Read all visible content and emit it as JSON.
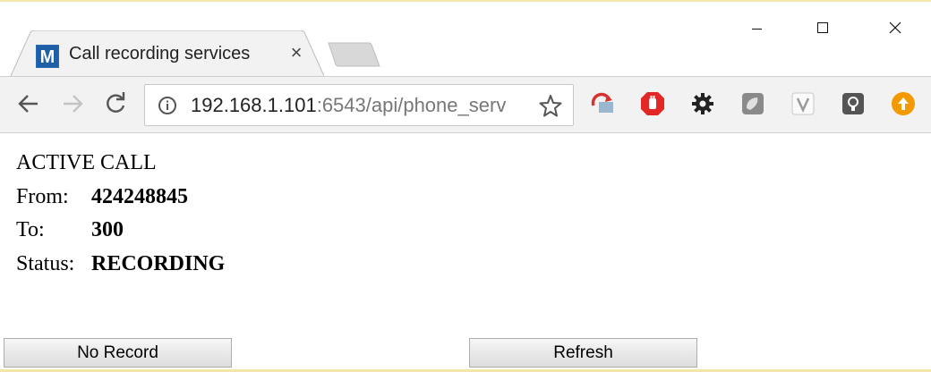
{
  "browser": {
    "tab": {
      "favicon_letter": "M",
      "title": "Call recording services",
      "close_glyph": "×"
    },
    "url": {
      "host": "192.168.1.101",
      "rest": ":6543/api/phone_serv"
    },
    "extensions": [
      "red-arrow-extension-icon",
      "adblock-hand-icon",
      "gear-icon",
      "grey-square-extension-icon",
      "shield-badge-extension-icon",
      "lightbulb-extension-icon",
      "orange-upload-icon"
    ]
  },
  "call": {
    "heading": "ACTIVE CALL",
    "from_label": "From:",
    "from_value": "424248845",
    "to_label": "To:",
    "to_value": "300",
    "status_label": "Status:",
    "status_value": "RECORDING"
  },
  "buttons": {
    "no_record": "No Record",
    "refresh": "Refresh"
  },
  "colors": {
    "favicon": "#1f5fa7",
    "adblock": "#e32626",
    "upload": "#f29a00"
  }
}
